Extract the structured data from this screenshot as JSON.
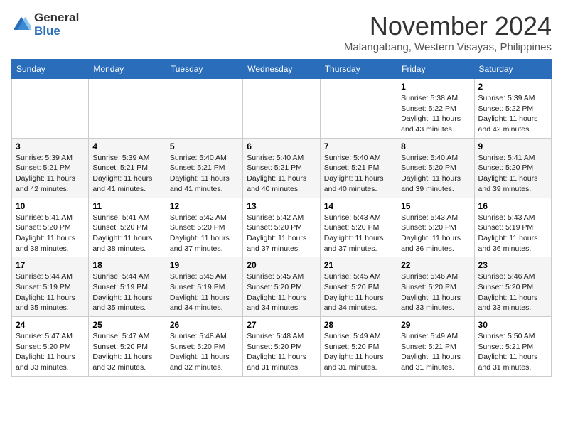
{
  "header": {
    "logo_general": "General",
    "logo_blue": "Blue",
    "month_title": "November 2024",
    "location": "Malangabang, Western Visayas, Philippines"
  },
  "days_of_week": [
    "Sunday",
    "Monday",
    "Tuesday",
    "Wednesday",
    "Thursday",
    "Friday",
    "Saturday"
  ],
  "weeks": [
    [
      {
        "day": "",
        "info": ""
      },
      {
        "day": "",
        "info": ""
      },
      {
        "day": "",
        "info": ""
      },
      {
        "day": "",
        "info": ""
      },
      {
        "day": "",
        "info": ""
      },
      {
        "day": "1",
        "info": "Sunrise: 5:38 AM\nSunset: 5:22 PM\nDaylight: 11 hours\nand 43 minutes."
      },
      {
        "day": "2",
        "info": "Sunrise: 5:39 AM\nSunset: 5:22 PM\nDaylight: 11 hours\nand 42 minutes."
      }
    ],
    [
      {
        "day": "3",
        "info": "Sunrise: 5:39 AM\nSunset: 5:21 PM\nDaylight: 11 hours\nand 42 minutes."
      },
      {
        "day": "4",
        "info": "Sunrise: 5:39 AM\nSunset: 5:21 PM\nDaylight: 11 hours\nand 41 minutes."
      },
      {
        "day": "5",
        "info": "Sunrise: 5:40 AM\nSunset: 5:21 PM\nDaylight: 11 hours\nand 41 minutes."
      },
      {
        "day": "6",
        "info": "Sunrise: 5:40 AM\nSunset: 5:21 PM\nDaylight: 11 hours\nand 40 minutes."
      },
      {
        "day": "7",
        "info": "Sunrise: 5:40 AM\nSunset: 5:21 PM\nDaylight: 11 hours\nand 40 minutes."
      },
      {
        "day": "8",
        "info": "Sunrise: 5:40 AM\nSunset: 5:20 PM\nDaylight: 11 hours\nand 39 minutes."
      },
      {
        "day": "9",
        "info": "Sunrise: 5:41 AM\nSunset: 5:20 PM\nDaylight: 11 hours\nand 39 minutes."
      }
    ],
    [
      {
        "day": "10",
        "info": "Sunrise: 5:41 AM\nSunset: 5:20 PM\nDaylight: 11 hours\nand 38 minutes."
      },
      {
        "day": "11",
        "info": "Sunrise: 5:41 AM\nSunset: 5:20 PM\nDaylight: 11 hours\nand 38 minutes."
      },
      {
        "day": "12",
        "info": "Sunrise: 5:42 AM\nSunset: 5:20 PM\nDaylight: 11 hours\nand 37 minutes."
      },
      {
        "day": "13",
        "info": "Sunrise: 5:42 AM\nSunset: 5:20 PM\nDaylight: 11 hours\nand 37 minutes."
      },
      {
        "day": "14",
        "info": "Sunrise: 5:43 AM\nSunset: 5:20 PM\nDaylight: 11 hours\nand 37 minutes."
      },
      {
        "day": "15",
        "info": "Sunrise: 5:43 AM\nSunset: 5:20 PM\nDaylight: 11 hours\nand 36 minutes."
      },
      {
        "day": "16",
        "info": "Sunrise: 5:43 AM\nSunset: 5:19 PM\nDaylight: 11 hours\nand 36 minutes."
      }
    ],
    [
      {
        "day": "17",
        "info": "Sunrise: 5:44 AM\nSunset: 5:19 PM\nDaylight: 11 hours\nand 35 minutes."
      },
      {
        "day": "18",
        "info": "Sunrise: 5:44 AM\nSunset: 5:19 PM\nDaylight: 11 hours\nand 35 minutes."
      },
      {
        "day": "19",
        "info": "Sunrise: 5:45 AM\nSunset: 5:19 PM\nDaylight: 11 hours\nand 34 minutes."
      },
      {
        "day": "20",
        "info": "Sunrise: 5:45 AM\nSunset: 5:20 PM\nDaylight: 11 hours\nand 34 minutes."
      },
      {
        "day": "21",
        "info": "Sunrise: 5:45 AM\nSunset: 5:20 PM\nDaylight: 11 hours\nand 34 minutes."
      },
      {
        "day": "22",
        "info": "Sunrise: 5:46 AM\nSunset: 5:20 PM\nDaylight: 11 hours\nand 33 minutes."
      },
      {
        "day": "23",
        "info": "Sunrise: 5:46 AM\nSunset: 5:20 PM\nDaylight: 11 hours\nand 33 minutes."
      }
    ],
    [
      {
        "day": "24",
        "info": "Sunrise: 5:47 AM\nSunset: 5:20 PM\nDaylight: 11 hours\nand 33 minutes."
      },
      {
        "day": "25",
        "info": "Sunrise: 5:47 AM\nSunset: 5:20 PM\nDaylight: 11 hours\nand 32 minutes."
      },
      {
        "day": "26",
        "info": "Sunrise: 5:48 AM\nSunset: 5:20 PM\nDaylight: 11 hours\nand 32 minutes."
      },
      {
        "day": "27",
        "info": "Sunrise: 5:48 AM\nSunset: 5:20 PM\nDaylight: 11 hours\nand 31 minutes."
      },
      {
        "day": "28",
        "info": "Sunrise: 5:49 AM\nSunset: 5:20 PM\nDaylight: 11 hours\nand 31 minutes."
      },
      {
        "day": "29",
        "info": "Sunrise: 5:49 AM\nSunset: 5:21 PM\nDaylight: 11 hours\nand 31 minutes."
      },
      {
        "day": "30",
        "info": "Sunrise: 5:50 AM\nSunset: 5:21 PM\nDaylight: 11 hours\nand 31 minutes."
      }
    ]
  ]
}
